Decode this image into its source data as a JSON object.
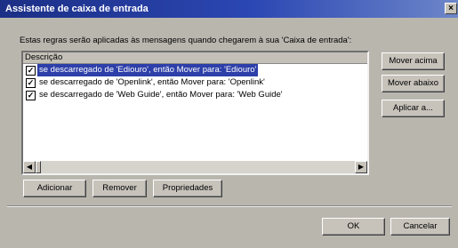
{
  "window": {
    "title": "Assistente de caixa de entrada",
    "close_glyph": "×"
  },
  "intro_text": "Estas regras serão aplicadas às mensagens quando chegarem à sua 'Caixa de entrada':",
  "list": {
    "header": "Descrição",
    "rows": [
      {
        "checked": true,
        "selected": true,
        "text": "se descarregado de 'Ediouro', então Mover para: 'Ediouro'"
      },
      {
        "checked": true,
        "selected": false,
        "text": "se descarregado de 'Openlink', então Mover para: 'Openlink'"
      },
      {
        "checked": true,
        "selected": false,
        "text": "se descarregado de 'Web Guide', então Mover para: 'Web Guide'"
      }
    ]
  },
  "side_buttons": {
    "move_up": "Mover acima",
    "move_down": "Mover abaixo",
    "apply": "Aplicar a..."
  },
  "bottom_buttons": {
    "add": "Adicionar",
    "remove": "Remover",
    "properties": "Propriedades"
  },
  "dialog_buttons": {
    "ok": "OK",
    "cancel": "Cancelar"
  },
  "icons": {
    "check": "checkbox-checked-icon",
    "scroll_left": "arrow-left-icon",
    "scroll_right": "arrow-right-icon"
  },
  "colors": {
    "title_bar": "#1c2f86",
    "selection": "#2d3fa8",
    "dialog_bg": "#b9b6ae"
  }
}
